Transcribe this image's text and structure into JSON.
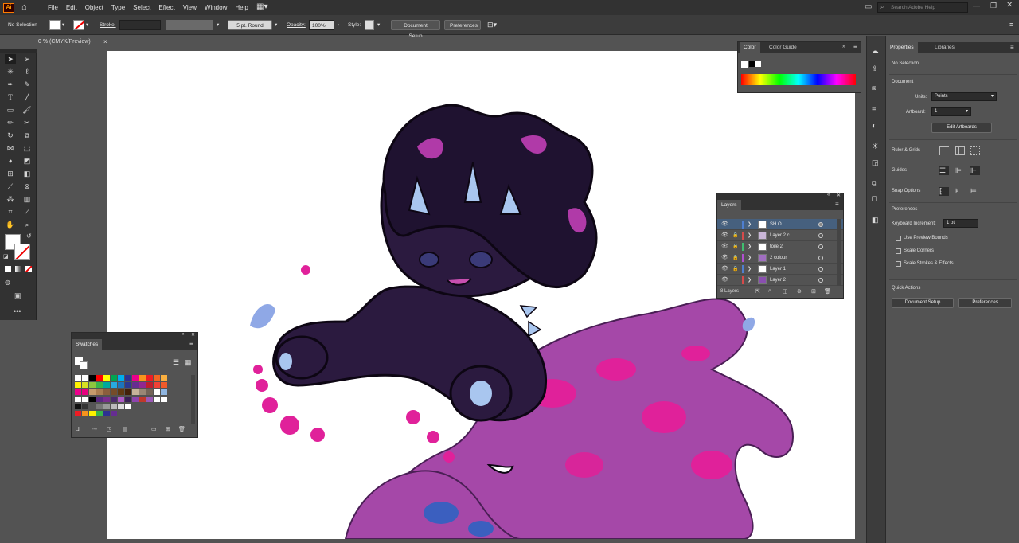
{
  "app": {
    "logo": "Ai",
    "menu": [
      "File",
      "Edit",
      "Object",
      "Type",
      "Select",
      "Effect",
      "View",
      "Window",
      "Help"
    ],
    "search_placeholder": "Search Adobe Help"
  },
  "controlbar": {
    "selection": "No Selection",
    "stroke_label": "Stroke:",
    "brush": "5 pt. Round",
    "opacity_label": "Opacity:",
    "opacity_value": "100%",
    "style_label": "Style:",
    "document_setup": "Document Setup",
    "preferences": "Preferences"
  },
  "document": {
    "tab_title": "0 % (CMYK/Preview)",
    "close": "×"
  },
  "color_panel": {
    "tabs": [
      "Color",
      "Color Guide"
    ],
    "active_tab": "Color"
  },
  "layers_panel": {
    "title": "Layers",
    "layers": [
      {
        "name": "SH O",
        "color": "#4f7fcf",
        "selected": true,
        "locked": false
      },
      {
        "name": "Layer 2 c...",
        "color": "#d64b4b",
        "selected": false,
        "locked": true
      },
      {
        "name": "toile 2",
        "color": "#3fbf6f",
        "selected": false,
        "locked": true
      },
      {
        "name": "2 colour",
        "color": "#b050d0",
        "selected": false,
        "locked": true
      },
      {
        "name": "Layer 1",
        "color": "#4f7fcf",
        "selected": false,
        "locked": true
      },
      {
        "name": "Layer 2",
        "color": "#d64b4b",
        "selected": false,
        "locked": false
      }
    ],
    "count": "8 Layers"
  },
  "swatches_panel": {
    "title": "Swatches",
    "rows": [
      [
        "#ffffff",
        "#ffffff",
        "#000000",
        "#ff0000",
        "#ffff00",
        "#00a651",
        "#00aeef",
        "#2e3192",
        "#ec008c",
        "#f7941d",
        "#ed1c24",
        "#f26522",
        "#fbb040"
      ],
      [
        "#fff200",
        "#d7df23",
        "#8dc63f",
        "#39b54a",
        "#00a99d",
        "#27aae1",
        "#1c75bc",
        "#2b3990",
        "#662d91",
        "#92278f",
        "#be1e2d",
        "#ef4136",
        "#f15a29"
      ],
      [
        "#ec008c",
        "#e6007e",
        "#c49a6c",
        "#a97c50",
        "#8b5e3c",
        "#754c29",
        "#603913",
        "#42210b",
        "#c7b299",
        "#998675",
        "#736357",
        "#ffffff",
        "#8fb5e0"
      ],
      [
        "#ffffff",
        "#ffffff",
        "#000000",
        "#5a2a82",
        "#7b2d8e",
        "#4b2a6b",
        "#b05cc8",
        "#3a1f57",
        "#8e44ad",
        "#c0392b",
        "#9b59b6",
        "#ffffff",
        "#ffffff"
      ],
      [
        "#111111",
        "#333333",
        "#555555",
        "#777777",
        "#999999",
        "#bbbbbb",
        "#dddddd",
        "#ffffff"
      ],
      [
        "#ed1c24",
        "#f7941d",
        "#fff200",
        "#39b54a",
        "#2e3192",
        "#662d91"
      ]
    ]
  },
  "properties": {
    "tabs": [
      "Properties",
      "Libraries"
    ],
    "active_tab": "Properties",
    "selection": "No Selection",
    "document_heading": "Document",
    "units_label": "Units:",
    "units_value": "Points",
    "artboard_label": "Artboard:",
    "artboard_value": "1",
    "edit_artboards": "Edit Artboards",
    "ruler_grids": "Ruler & Grids",
    "guides": "Guides",
    "snap_options": "Snap Options",
    "preferences_heading": "Preferences",
    "keyboard_increment_label": "Keyboard Increment:",
    "keyboard_increment_value": "1 pt",
    "checkboxes": [
      "Use Preview Bounds",
      "Scale Corners",
      "Scale Strokes & Effects"
    ],
    "quick_actions": "Quick Actions",
    "document_setup": "Document Setup",
    "preferences": "Preferences"
  }
}
